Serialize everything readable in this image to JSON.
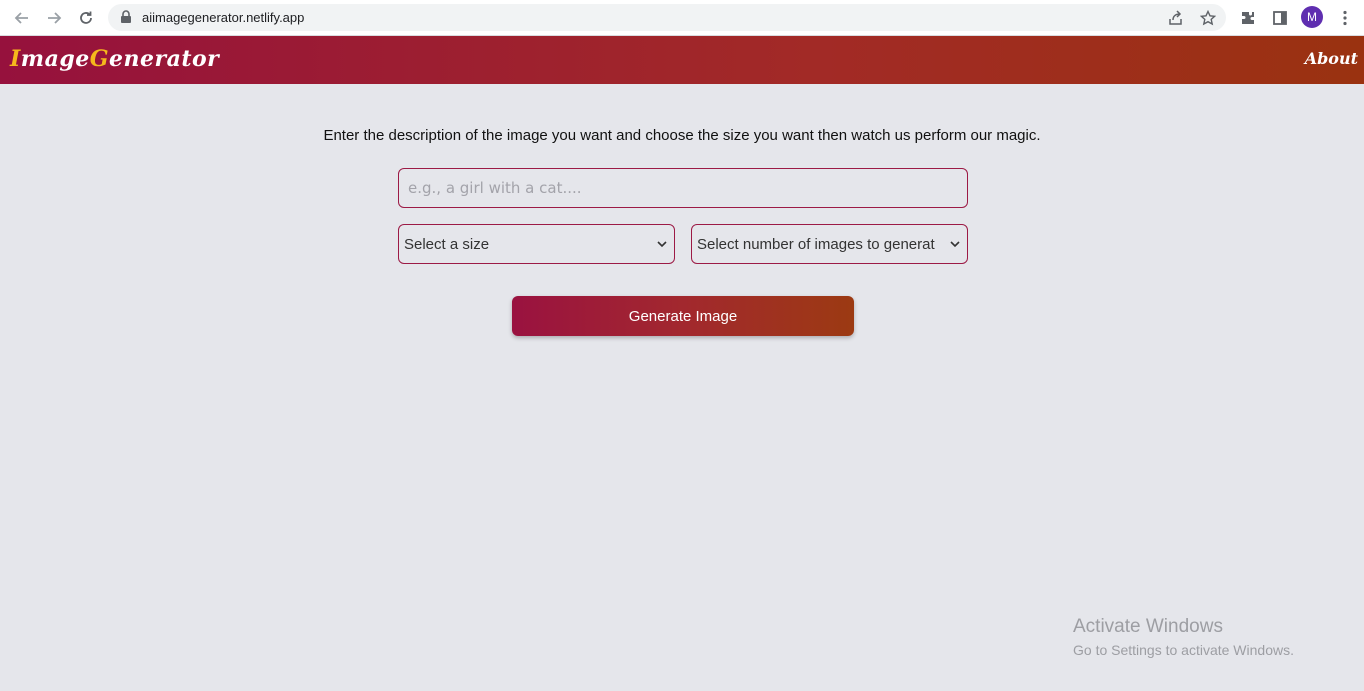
{
  "browser": {
    "url": "aiimagegenerator.netlify.app",
    "avatar_letter": "M",
    "icons": [
      "back-arrow-icon",
      "forward-arrow-icon",
      "reload-icon",
      "lock-icon",
      "share-icon",
      "star-icon",
      "extensions-icon",
      "side-panel-icon",
      "menu-icon"
    ]
  },
  "header": {
    "logo_first_letter": "I",
    "logo_part1": "mage",
    "logo_second_letter": "G",
    "logo_part2": "enerator",
    "about_label": "About"
  },
  "main": {
    "intro": "Enter the description of the image you want and choose the size you want then watch us perform our magic.",
    "prompt_placeholder": "e.g., a girl with a cat....",
    "size_select": "Select a size",
    "count_select": "Select number of images to generat",
    "generate_label": "Generate Image"
  },
  "watermark": {
    "title": "Activate Windows",
    "subtitle": "Go to Settings to activate Windows."
  },
  "colors": {
    "accent": "#9c1a45",
    "logo_highlight": "#f5b91c",
    "page_bg": "#e5e6eb"
  }
}
